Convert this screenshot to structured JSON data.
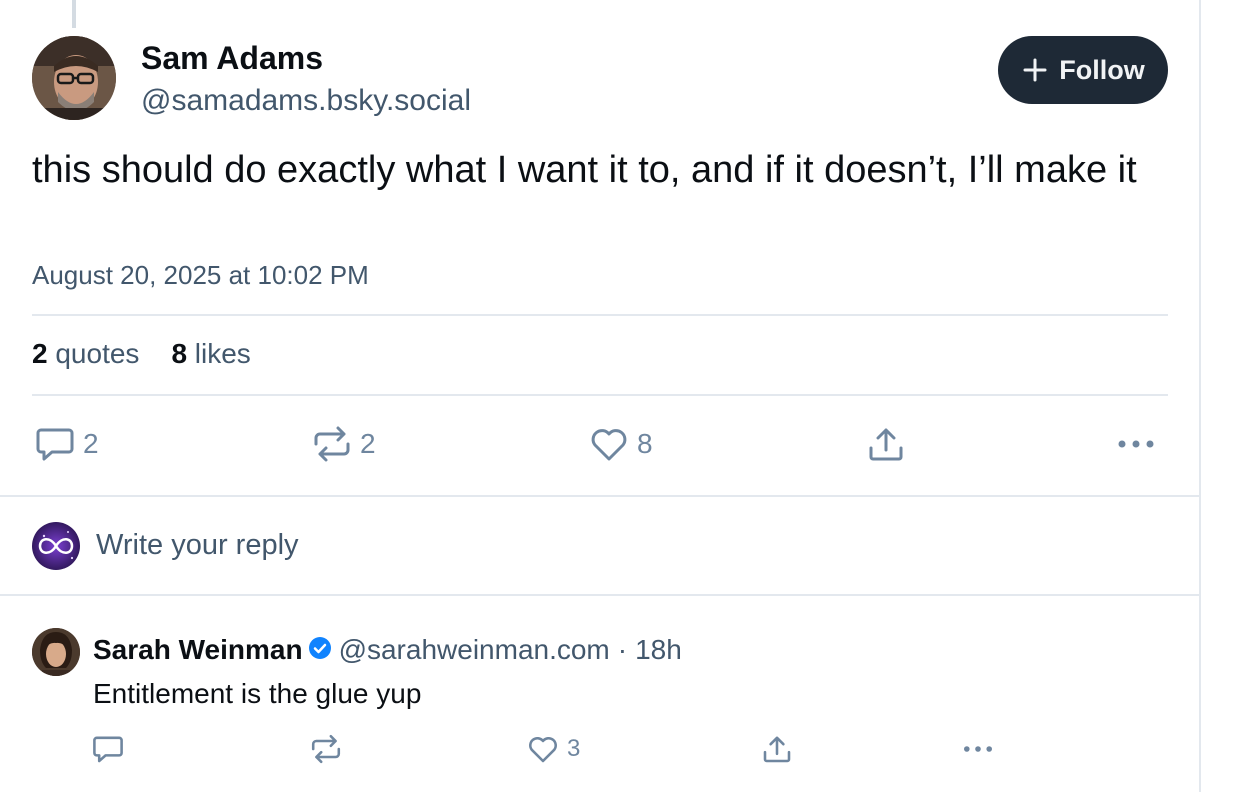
{
  "post": {
    "author_name": "Sam Adams",
    "author_handle": "@samadams.bsky.social",
    "follow_label": "Follow",
    "text": "this should do exactly what I want it to, and if it doesn’t, I’ll make it",
    "timestamp": "August 20, 2025 at 10:02 PM",
    "stats": {
      "quotes_count": "2",
      "quotes_label": "quotes",
      "likes_count": "8",
      "likes_label": "likes"
    },
    "actions": {
      "reply_count": "2",
      "repost_count": "2",
      "like_count": "8"
    }
  },
  "composer": {
    "placeholder": "Write your reply"
  },
  "reply": {
    "author_name": "Sarah Weinman",
    "author_handle": "@sarahweinman.com",
    "separator": "·",
    "time": "18h",
    "text": "Entitlement is the glue yup",
    "actions": {
      "like_count": "3"
    }
  },
  "icons": {
    "reply": "speech-bubble-icon",
    "repost": "repost-arrows-icon",
    "like": "heart-icon",
    "share": "share-upload-icon",
    "more": "more-dots-icon",
    "verified": "verified-check-icon",
    "plus": "plus-icon"
  },
  "colors": {
    "follow_bg": "#1e2936",
    "muted_text": "#42576c",
    "icon": "#6f869f",
    "verified": "#1083fe",
    "divider": "#e3e8ee"
  }
}
